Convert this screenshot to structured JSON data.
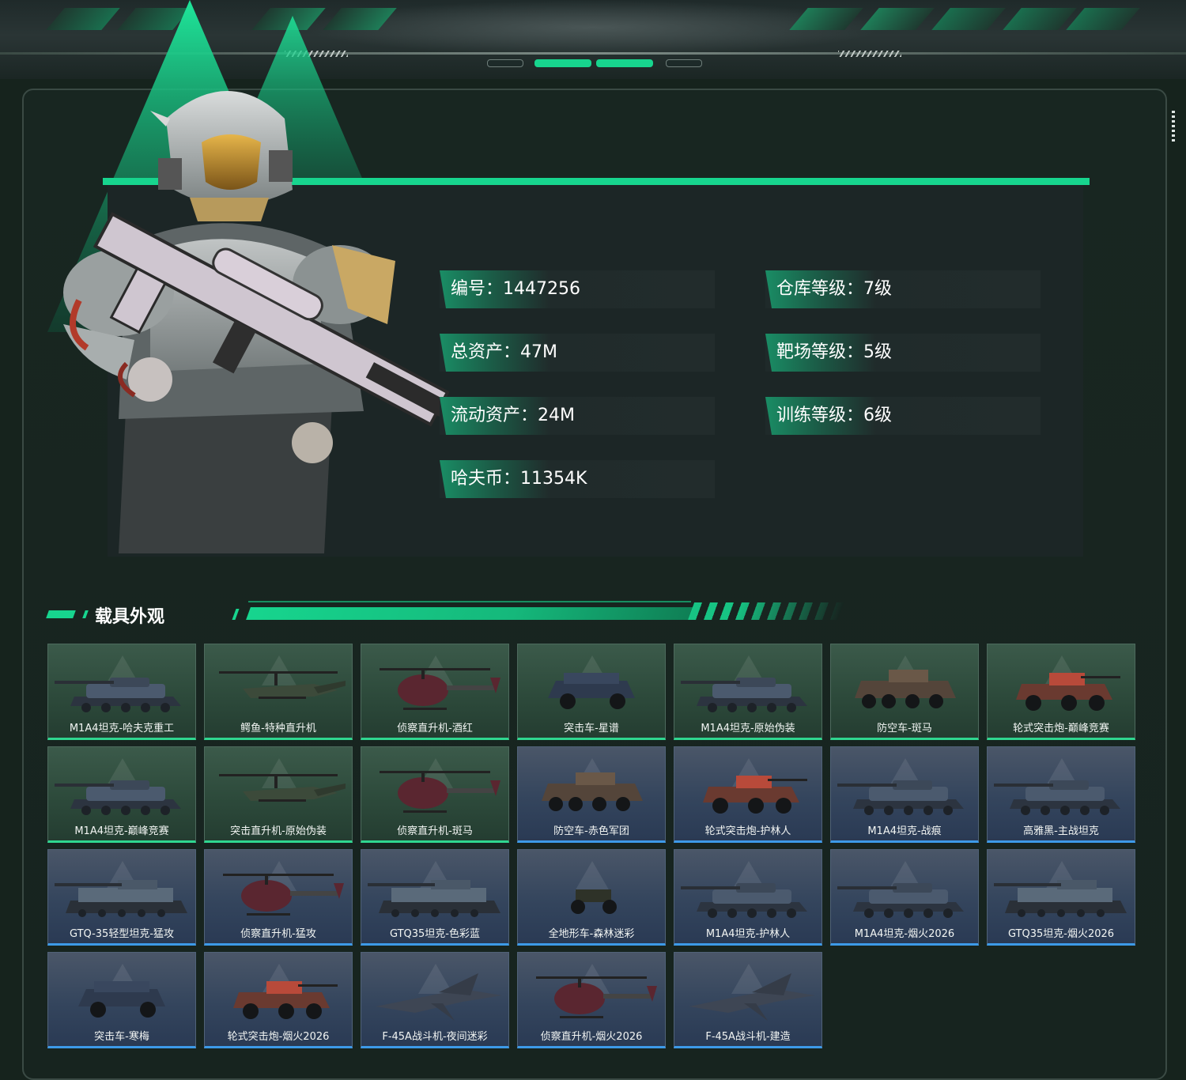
{
  "profile": {
    "stats": [
      {
        "label": "编号",
        "value": "1447256",
        "text": "编号：1447256"
      },
      {
        "label": "总资产",
        "value": "47M",
        "text": "总资产：47M"
      },
      {
        "label": "流动资产",
        "value": "24M",
        "text": "流动资产：24M"
      },
      {
        "label": "哈夫币",
        "value": "11354K",
        "text": "哈夫币：11354K"
      },
      {
        "label": "仓库等级",
        "value": "7级",
        "text": "仓库等级：7级"
      },
      {
        "label": "靶场等级",
        "value": "5级",
        "text": "靶场等级：5级"
      },
      {
        "label": "训练等级",
        "value": "6级",
        "text": "训练等级：6级"
      }
    ]
  },
  "section": {
    "title": "载具外观"
  },
  "vehicles": [
    {
      "name": "M1A4坦克-哈夫克重工",
      "type": "tank",
      "rarity": "green"
    },
    {
      "name": "鳄鱼-特种直升机",
      "type": "attack-heli",
      "rarity": "green"
    },
    {
      "name": "侦察直升机-酒红",
      "type": "scout-heli",
      "rarity": "green"
    },
    {
      "name": "突击车-星谱",
      "type": "assault-car",
      "rarity": "green"
    },
    {
      "name": "M1A4坦克-原始伪装",
      "type": "tank",
      "rarity": "green"
    },
    {
      "name": "防空车-斑马",
      "type": "aa-vehicle",
      "rarity": "green"
    },
    {
      "name": "轮式突击炮-巅峰竞赛",
      "type": "wheeled-gun",
      "rarity": "green"
    },
    {
      "name": "M1A4坦克-巅峰竞赛",
      "type": "tank",
      "rarity": "green"
    },
    {
      "name": "突击直升机-原始伪装",
      "type": "attack-heli",
      "rarity": "green"
    },
    {
      "name": "侦察直升机-斑马",
      "type": "scout-heli",
      "rarity": "green"
    },
    {
      "name": "防空车-赤色军团",
      "type": "aa-vehicle",
      "rarity": "blue"
    },
    {
      "name": "轮式突击炮-护林人",
      "type": "wheeled-gun",
      "rarity": "blue"
    },
    {
      "name": "M1A4坦克-战痕",
      "type": "tank",
      "rarity": "blue"
    },
    {
      "name": "高雅黑-主战坦克",
      "type": "tank",
      "rarity": "blue"
    },
    {
      "name": "GTQ-35轻型坦克-猛攻",
      "type": "light-tank",
      "rarity": "blue"
    },
    {
      "name": "侦察直升机-猛攻",
      "type": "scout-heli",
      "rarity": "blue"
    },
    {
      "name": "GTQ35坦克-色彩蓝",
      "type": "light-tank",
      "rarity": "blue"
    },
    {
      "name": "全地形车-森林迷彩",
      "type": "atv",
      "rarity": "blue"
    },
    {
      "name": "M1A4坦克-护林人",
      "type": "tank",
      "rarity": "blue"
    },
    {
      "name": "M1A4坦克-烟火2026",
      "type": "tank",
      "rarity": "blue"
    },
    {
      "name": "GTQ35坦克-烟火2026",
      "type": "light-tank",
      "rarity": "blue"
    },
    {
      "name": "突击车-寒梅",
      "type": "assault-car",
      "rarity": "blue"
    },
    {
      "name": "轮式突击炮-烟火2026",
      "type": "wheeled-gun",
      "rarity": "blue"
    },
    {
      "name": "F-45A战斗机-夜间迷彩",
      "type": "jet",
      "rarity": "blue"
    },
    {
      "name": "侦察直升机-烟火2026",
      "type": "scout-heli",
      "rarity": "blue"
    },
    {
      "name": "F-45A战斗机-建造",
      "type": "jet",
      "rarity": "blue"
    }
  ],
  "colors": {
    "accent": "#17d58e",
    "background": "#16231d",
    "tile_green": "#2d4a3b",
    "tile_blue": "#34455d",
    "rarity_green_bar": "#2fd690",
    "rarity_blue_bar": "#3d9ae8"
  },
  "images": {
    "hero": "operator-soldier-with-rifle"
  }
}
